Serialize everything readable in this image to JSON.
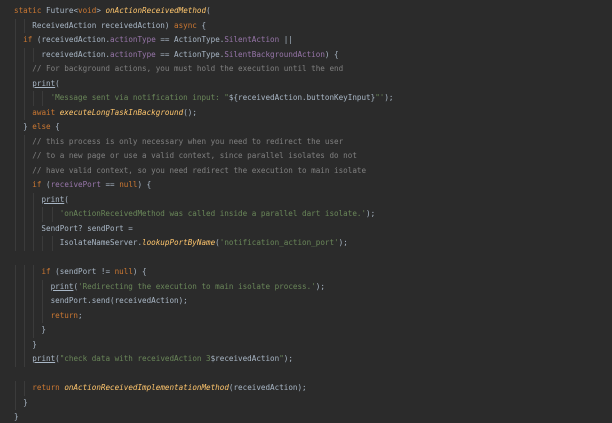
{
  "lines": [
    [
      {
        "t": "static ",
        "c": "kw"
      },
      {
        "t": "Future<",
        "c": ""
      },
      {
        "t": "void",
        "c": "kw"
      },
      {
        "t": "> ",
        "c": ""
      },
      {
        "t": "onActionReceivedMethod",
        "c": "fn"
      },
      {
        "t": "(",
        "c": ""
      }
    ],
    [
      {
        "t": "    ReceivedAction receivedAction) ",
        "c": ""
      },
      {
        "t": "async",
        "c": "kw"
      },
      {
        "t": " {",
        "c": ""
      }
    ],
    [
      {
        "t": "  ",
        "c": ""
      },
      {
        "t": "if",
        "c": "kw"
      },
      {
        "t": " (receivedAction.",
        "c": ""
      },
      {
        "t": "actionType",
        "c": "fld"
      },
      {
        "t": " == ActionType.",
        "c": ""
      },
      {
        "t": "SilentAction",
        "c": "fld"
      },
      {
        "t": " ||",
        "c": ""
      }
    ],
    [
      {
        "t": "      receivedAction.",
        "c": ""
      },
      {
        "t": "actionType",
        "c": "fld"
      },
      {
        "t": " == ActionType.",
        "c": ""
      },
      {
        "t": "SilentBackgroundAction",
        "c": "fld"
      },
      {
        "t": ") {",
        "c": ""
      }
    ],
    [
      {
        "t": "    // For background actions, you must hold the execution until the end",
        "c": "cmt"
      }
    ],
    [
      {
        "t": "    ",
        "c": ""
      },
      {
        "t": "print",
        "c": "ul"
      },
      {
        "t": "(",
        "c": ""
      }
    ],
    [
      {
        "t": "        ",
        "c": ""
      },
      {
        "t": "'Message sent via notification input: \"",
        "c": "str"
      },
      {
        "t": "${receivedAction.buttonKeyInput}",
        "c": ""
      },
      {
        "t": "\"'",
        "c": "str"
      },
      {
        "t": ");",
        "c": ""
      }
    ],
    [
      {
        "t": "    ",
        "c": ""
      },
      {
        "t": "await ",
        "c": "kw"
      },
      {
        "t": "executeLongTaskInBackground",
        "c": "fn"
      },
      {
        "t": "();",
        "c": ""
      }
    ],
    [
      {
        "t": "  } ",
        "c": ""
      },
      {
        "t": "else",
        "c": "kw"
      },
      {
        "t": " {",
        "c": ""
      }
    ],
    [
      {
        "t": "    // this process is only necessary when you need to redirect the user",
        "c": "cmt"
      }
    ],
    [
      {
        "t": "    // to a new page or use a valid context, since parallel isolates do not",
        "c": "cmt"
      }
    ],
    [
      {
        "t": "    // have valid context, so you need redirect the execution to main isolate",
        "c": "cmt"
      }
    ],
    [
      {
        "t": "    ",
        "c": ""
      },
      {
        "t": "if",
        "c": "kw"
      },
      {
        "t": " (",
        "c": ""
      },
      {
        "t": "receivePort",
        "c": "fld"
      },
      {
        "t": " == ",
        "c": ""
      },
      {
        "t": "null",
        "c": "kw"
      },
      {
        "t": ") {",
        "c": ""
      }
    ],
    [
      {
        "t": "      ",
        "c": ""
      },
      {
        "t": "print",
        "c": "ul"
      },
      {
        "t": "(",
        "c": ""
      }
    ],
    [
      {
        "t": "          ",
        "c": ""
      },
      {
        "t": "'onActionReceivedMethod was called inside a parallel dart isolate.'",
        "c": "str"
      },
      {
        "t": ");",
        "c": ""
      }
    ],
    [
      {
        "t": "      SendPort? sendPort =",
        "c": ""
      }
    ],
    [
      {
        "t": "          IsolateNameServer.",
        "c": ""
      },
      {
        "t": "lookupPortByName",
        "c": "fn"
      },
      {
        "t": "(",
        "c": ""
      },
      {
        "t": "'notification_action_port'",
        "c": "str"
      },
      {
        "t": ");",
        "c": ""
      }
    ],
    [
      {
        "t": "",
        "c": ""
      }
    ],
    [
      {
        "t": "      ",
        "c": ""
      },
      {
        "t": "if",
        "c": "kw"
      },
      {
        "t": " (sendPort != ",
        "c": ""
      },
      {
        "t": "null",
        "c": "kw"
      },
      {
        "t": ") {",
        "c": ""
      }
    ],
    [
      {
        "t": "        ",
        "c": ""
      },
      {
        "t": "print",
        "c": "ul"
      },
      {
        "t": "(",
        "c": ""
      },
      {
        "t": "'Redirecting the execution to main isolate process.'",
        "c": "str"
      },
      {
        "t": ");",
        "c": ""
      }
    ],
    [
      {
        "t": "        sendPort.send(receivedAction);",
        "c": ""
      }
    ],
    [
      {
        "t": "        ",
        "c": ""
      },
      {
        "t": "return",
        "c": "kw"
      },
      {
        "t": ";",
        "c": ""
      }
    ],
    [
      {
        "t": "      }",
        "c": ""
      }
    ],
    [
      {
        "t": "    }",
        "c": ""
      }
    ],
    [
      {
        "t": "    ",
        "c": ""
      },
      {
        "t": "print",
        "c": "ul"
      },
      {
        "t": "(",
        "c": ""
      },
      {
        "t": "\"check data with receivedAction 3",
        "c": "str"
      },
      {
        "t": "$receivedAction",
        "c": ""
      },
      {
        "t": "\"",
        "c": "str"
      },
      {
        "t": ");",
        "c": ""
      }
    ],
    [
      {
        "t": "",
        "c": ""
      }
    ],
    [
      {
        "t": "    ",
        "c": ""
      },
      {
        "t": "return ",
        "c": "kw"
      },
      {
        "t": "onActionReceivedImplementationMethod",
        "c": "fn"
      },
      {
        "t": "(receivedAction);",
        "c": ""
      }
    ],
    [
      {
        "t": "  }",
        "c": ""
      }
    ],
    [
      {
        "t": "}",
        "c": ""
      }
    ]
  ]
}
